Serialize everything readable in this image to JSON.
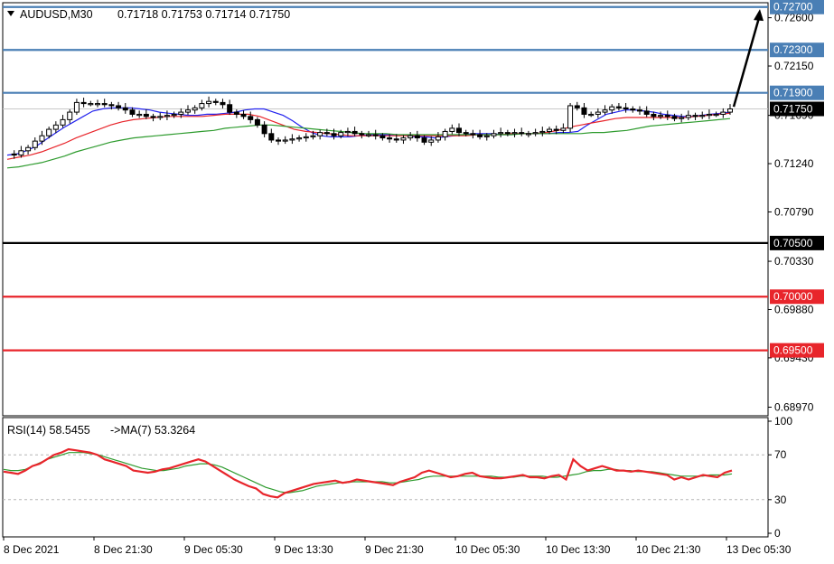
{
  "header": {
    "symbol": "AUDUSD,M30",
    "ohlc": "0.71718 0.71753 0.71714 0.71750"
  },
  "rsi_header": {
    "rsi": "RSI(14) 58.5455",
    "ma": "->MA(7) 53.3264"
  },
  "price_axis": {
    "ticks": [
      "0.72600",
      "0.72150",
      "0.71690",
      "0.71240",
      "0.70790",
      "0.70330",
      "0.69880",
      "0.69430",
      "0.68970"
    ]
  },
  "rsi_axis": {
    "ticks": [
      "100",
      "70",
      "30",
      "0"
    ]
  },
  "time_axis": {
    "ticks": [
      "8 Dec 2021",
      "8 Dec 21:30",
      "9 Dec 05:30",
      "9 Dec 13:30",
      "9 Dec 21:30",
      "10 Dec 05:30",
      "10 Dec 13:30",
      "10 Dec 21:30",
      "13 Dec 05:30"
    ]
  },
  "chart_data": {
    "type": "candlestick",
    "symbol": "AUDUSD",
    "timeframe": "M30",
    "ylim": [
      0.6889,
      0.7274
    ],
    "current_price": {
      "label": "0.71750",
      "value": 0.7175,
      "color": "#000000"
    },
    "levels": [
      {
        "label": "0.72700",
        "value": 0.727,
        "color": "#4a7fb5"
      },
      {
        "label": "0.72300",
        "value": 0.723,
        "color": "#4a7fb5"
      },
      {
        "label": "0.71900",
        "value": 0.719,
        "color": "#4a7fb5"
      },
      {
        "label": "0.70500",
        "value": 0.705,
        "color": "#000000"
      },
      {
        "label": "0.70000",
        "value": 0.7,
        "color": "#e8252b"
      },
      {
        "label": "0.69500",
        "value": 0.695,
        "color": "#e8252b"
      }
    ],
    "forecast_arrow": {
      "from": 0.7177,
      "to": 0.7268,
      "color": "#000000"
    },
    "price_path": [
      0.7133,
      0.7132,
      0.7136,
      0.7139,
      0.7145,
      0.715,
      0.7156,
      0.716,
      0.7165,
      0.7172,
      0.7181,
      0.718,
      0.718,
      0.718,
      0.7179,
      0.7178,
      0.7176,
      0.7174,
      0.717,
      0.717,
      0.7168,
      0.7167,
      0.7168,
      0.7169,
      0.717,
      0.7172,
      0.7174,
      0.7176,
      0.718,
      0.7182,
      0.7181,
      0.7179,
      0.7172,
      0.717,
      0.7168,
      0.7165,
      0.716,
      0.7152,
      0.7146,
      0.7145,
      0.7146,
      0.7147,
      0.7148,
      0.7149,
      0.715,
      0.7153,
      0.7152,
      0.715,
      0.7153,
      0.7154,
      0.7152,
      0.7151,
      0.7151,
      0.715,
      0.7148,
      0.7147,
      0.7146,
      0.7148,
      0.715,
      0.7148,
      0.7144,
      0.7146,
      0.7149,
      0.7154,
      0.7157,
      0.7153,
      0.7152,
      0.7151,
      0.7149,
      0.715,
      0.7152,
      0.7153,
      0.7152,
      0.7153,
      0.7152,
      0.7152,
      0.7153,
      0.7154,
      0.7156,
      0.7155,
      0.7157,
      0.7178,
      0.7176,
      0.717,
      0.717,
      0.7172,
      0.7174,
      0.7177,
      0.7176,
      0.7175,
      0.7174,
      0.7173,
      0.717,
      0.7168,
      0.7169,
      0.7168,
      0.7166,
      0.7167,
      0.7169,
      0.7168,
      0.7169,
      0.717,
      0.717,
      0.7172,
      0.7175
    ],
    "moving_averages": [
      {
        "color": "#2222ee",
        "values": [
          0.7132,
          0.7133,
          0.7136,
          0.714,
          0.7146,
          0.7152,
          0.7158,
          0.7163,
          0.7168,
          0.7173,
          0.7175,
          0.7176,
          0.7176,
          0.7176,
          0.7175,
          0.7174,
          0.7172,
          0.7171,
          0.717,
          0.7169,
          0.7169,
          0.717,
          0.717,
          0.7171,
          0.7172,
          0.7174,
          0.7175,
          0.7175,
          0.7172,
          0.7169,
          0.7164,
          0.7158,
          0.7153,
          0.715,
          0.7149,
          0.7149,
          0.7149,
          0.715,
          0.7151,
          0.7151,
          0.7151,
          0.7151,
          0.715,
          0.7149,
          0.7149,
          0.7148,
          0.7149,
          0.715,
          0.7151,
          0.7152,
          0.7152,
          0.7152,
          0.7151,
          0.7151,
          0.7152,
          0.7152,
          0.7152,
          0.7152,
          0.7153,
          0.7153,
          0.7154,
          0.716,
          0.7165,
          0.717,
          0.7172,
          0.7174,
          0.7174,
          0.7173,
          0.7172,
          0.717,
          0.7169,
          0.7168,
          0.7168,
          0.7169,
          0.717,
          0.7171,
          0.7172
        ]
      },
      {
        "color": "#e8252b",
        "values": [
          0.7128,
          0.713,
          0.7132,
          0.7135,
          0.7139,
          0.7143,
          0.7148,
          0.7152,
          0.7156,
          0.716,
          0.7163,
          0.7165,
          0.7166,
          0.7167,
          0.7168,
          0.7168,
          0.7168,
          0.7168,
          0.7169,
          0.717,
          0.717,
          0.717,
          0.7168,
          0.7164,
          0.716,
          0.7156,
          0.7154,
          0.7153,
          0.7152,
          0.7151,
          0.715,
          0.715,
          0.715,
          0.715,
          0.715,
          0.715,
          0.715,
          0.715,
          0.715,
          0.715,
          0.715,
          0.7151,
          0.7151,
          0.7151,
          0.7152,
          0.7152,
          0.7152,
          0.7153,
          0.7155,
          0.7158,
          0.716,
          0.7162,
          0.7164,
          0.7166,
          0.7167,
          0.7167,
          0.7167,
          0.7167,
          0.7167,
          0.7167,
          0.7168,
          0.7169,
          0.717,
          0.7171
        ]
      },
      {
        "color": "#2e9b2e",
        "values": [
          0.712,
          0.7121,
          0.7123,
          0.7125,
          0.7128,
          0.7131,
          0.7135,
          0.7138,
          0.7141,
          0.7144,
          0.7146,
          0.7148,
          0.7149,
          0.715,
          0.7151,
          0.7152,
          0.7153,
          0.7154,
          0.7155,
          0.7157,
          0.7158,
          0.7159,
          0.716,
          0.716,
          0.7159,
          0.7158,
          0.7157,
          0.7156,
          0.7155,
          0.7154,
          0.7153,
          0.7152,
          0.7152,
          0.7152,
          0.7151,
          0.7151,
          0.7151,
          0.7151,
          0.7151,
          0.7151,
          0.7151,
          0.7151,
          0.7151,
          0.7151,
          0.7151,
          0.7152,
          0.7152,
          0.7152,
          0.7152,
          0.7152,
          0.7152,
          0.7153,
          0.7153,
          0.7154,
          0.7155,
          0.7157,
          0.7159,
          0.716,
          0.7161,
          0.7162,
          0.7163,
          0.7164,
          0.7165,
          0.7166
        ]
      }
    ],
    "rsi": {
      "period": 14,
      "value": 58.5455,
      "ma_period": 7,
      "ma_value": 53.3264,
      "levels": [
        70,
        30
      ],
      "ylim": [
        0,
        100
      ],
      "rsi_color": "#e8252b",
      "ma_color": "#2e9b2e",
      "rsi_values": [
        55,
        54,
        53,
        56,
        60,
        62,
        66,
        70,
        72,
        75,
        74,
        73,
        72,
        70,
        66,
        64,
        62,
        60,
        56,
        55,
        54,
        55,
        57,
        58,
        60,
        62,
        64,
        66,
        64,
        60,
        56,
        52,
        48,
        45,
        42,
        40,
        35,
        33,
        32,
        36,
        38,
        40,
        42,
        44,
        45,
        46,
        47,
        45,
        46,
        48,
        47,
        46,
        45,
        44,
        43,
        46,
        48,
        50,
        54,
        56,
        54,
        52,
        50,
        51,
        53,
        54,
        51,
        50,
        49,
        49,
        50,
        51,
        52,
        50,
        50,
        49,
        51,
        52,
        48,
        66,
        60,
        56,
        58,
        60,
        58,
        56,
        56,
        55,
        56,
        55,
        54,
        53,
        52,
        48,
        50,
        48,
        50,
        52,
        51,
        50,
        54,
        56
      ],
      "ma_values": [
        57,
        56,
        56,
        57,
        60,
        63,
        66,
        68,
        70,
        72,
        72,
        72,
        71,
        70,
        68,
        66,
        64,
        62,
        60,
        58,
        57,
        56,
        56,
        57,
        58,
        60,
        61,
        62,
        62,
        61,
        59,
        56,
        53,
        50,
        47,
        44,
        41,
        39,
        37,
        36,
        37,
        38,
        40,
        42,
        43,
        44,
        45,
        45,
        46,
        46,
        46,
        46,
        46,
        45,
        45,
        46,
        47,
        48,
        50,
        51,
        51,
        51,
        51,
        51,
        51,
        51,
        51,
        51,
        50,
        50,
        50,
        51,
        51,
        51,
        51,
        50,
        50,
        51,
        52,
        53,
        55,
        56,
        56,
        57,
        57,
        56,
        56,
        55,
        55,
        55,
        54,
        53,
        52,
        51,
        51,
        51,
        51,
        52,
        52,
        52,
        53
      ]
    }
  }
}
